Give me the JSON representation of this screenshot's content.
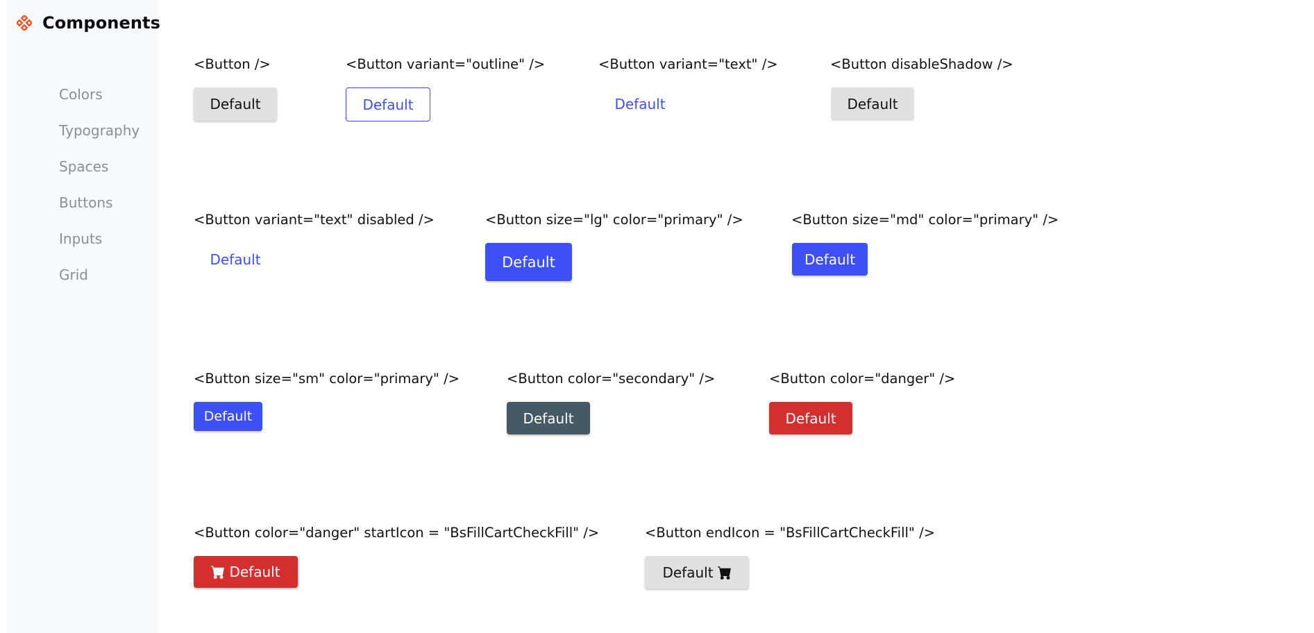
{
  "app": {
    "title": "Components"
  },
  "sidebar": {
    "items": [
      {
        "label": "Colors"
      },
      {
        "label": "Typography"
      },
      {
        "label": "Spaces"
      },
      {
        "label": "Buttons"
      },
      {
        "label": "Inputs"
      },
      {
        "label": "Grid"
      }
    ]
  },
  "demos": [
    {
      "label": "<Button />",
      "button": "Default"
    },
    {
      "label": "<Button variant=\"outline\" />",
      "button": "Default"
    },
    {
      "label": "<Button variant=\"text\" />",
      "button": "Default"
    },
    {
      "label": "<Button disableShadow />",
      "button": "Default"
    },
    {
      "label": "<Button variant=\"text\" disabled />",
      "button": "Default"
    },
    {
      "label": "<Button size=\"lg\" color=\"primary\" />",
      "button": "Default"
    },
    {
      "label": "<Button size=\"md\" color=\"primary\" />",
      "button": "Default"
    },
    {
      "label": "<Button size=\"sm\" color=\"primary\" />",
      "button": "Default"
    },
    {
      "label": "<Button color=\"secondary\" />",
      "button": "Default"
    },
    {
      "label": "<Button color=\"danger\" />",
      "button": "Default"
    },
    {
      "label": "<Button color=\"danger\" startIcon = \"BsFillCartCheckFill\" />",
      "button": "Default"
    },
    {
      "label": "<Button endIcon = \"BsFillCartCheckFill\" />",
      "button": "Default"
    }
  ],
  "icons": {
    "brand": "diamond-grid-icon",
    "cart": "cart-check-fill-icon"
  },
  "colors": {
    "primary": "#3d50f5",
    "secondary": "#455a64",
    "danger": "#d32f2f",
    "default": "#e0e0e0",
    "brand_accent": "#f4511e",
    "sidebar_bg": "#f8f9fc",
    "nav_text": "#8d8d8d"
  }
}
